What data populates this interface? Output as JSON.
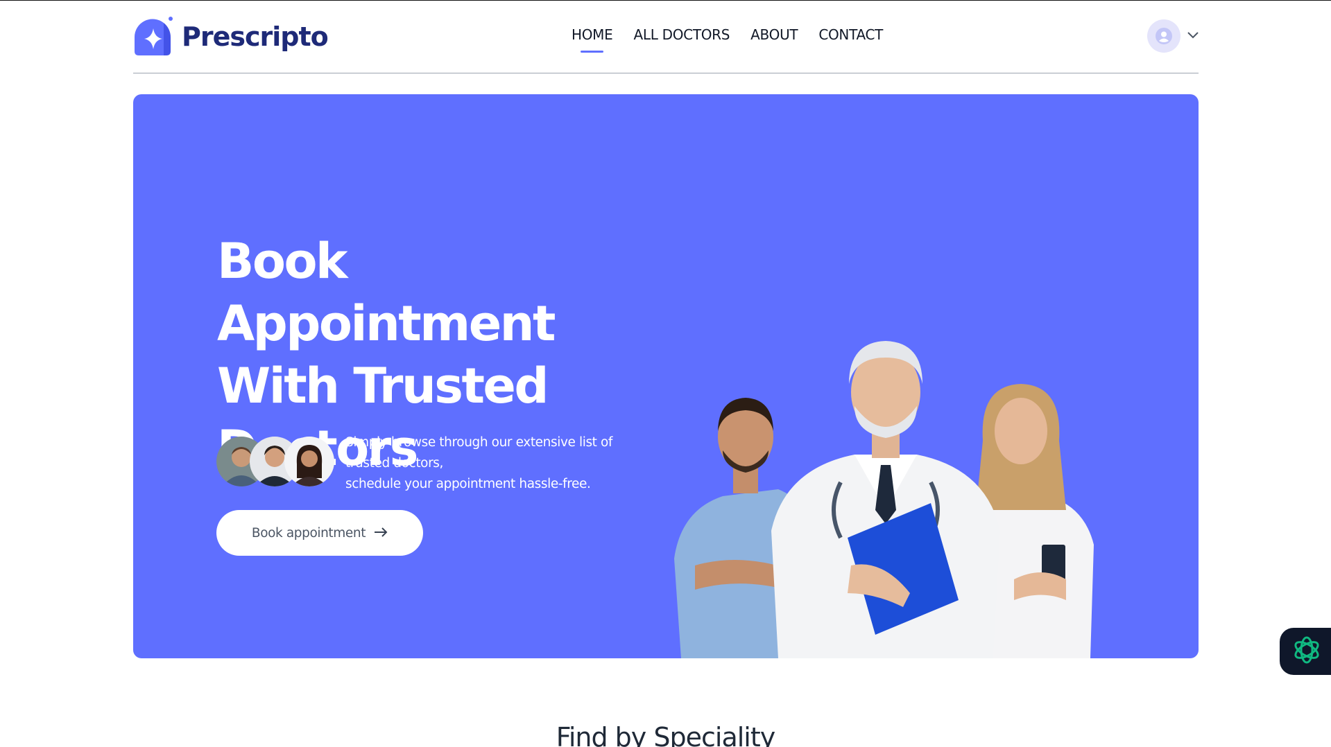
{
  "brand": {
    "name": "Prescripto",
    "color": "#1e2a78",
    "accent": "#5f6fff"
  },
  "nav": {
    "links": [
      {
        "label": "HOME",
        "active": true
      },
      {
        "label": "ALL DOCTORS",
        "active": false
      },
      {
        "label": "ABOUT",
        "active": false
      },
      {
        "label": "CONTACT",
        "active": false
      }
    ],
    "profile_icon": "user-icon",
    "dropdown_icon": "chevron-down-icon"
  },
  "hero": {
    "title_lines": [
      "Book Appointment",
      "With Trusted",
      "Doctors"
    ],
    "description_lines": [
      "Simply browse through our extensive list of",
      "trusted doctors,",
      "schedule your appointment hassle-free."
    ],
    "cta_label": "Book appointment",
    "cta_icon": "arrow-right-icon",
    "background": "#5f6fff"
  },
  "section": {
    "title": "Find by Speciality"
  },
  "floating_button": {
    "icon": "ai-assistant-icon"
  }
}
